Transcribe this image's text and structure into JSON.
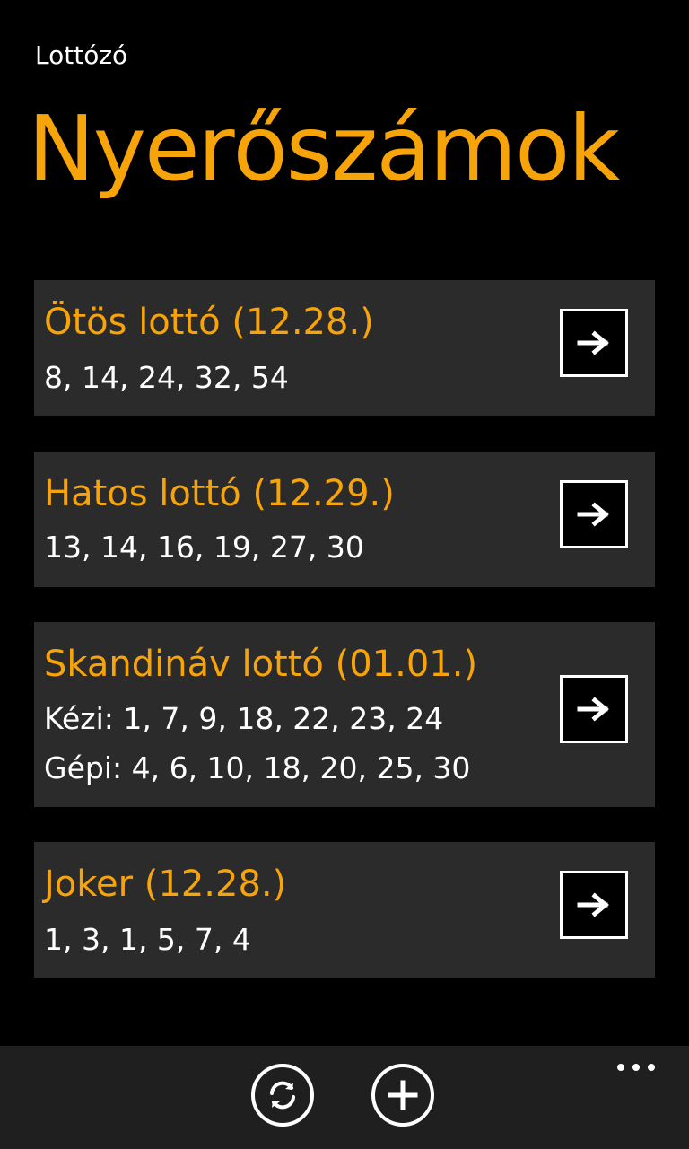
{
  "app": {
    "title": "Lottózó"
  },
  "page": {
    "title": "Nyerőszámok"
  },
  "cards": [
    {
      "title": "Ötös lottó (12.28.)",
      "lines": [
        "8, 14, 24, 32, 54"
      ]
    },
    {
      "title": "Hatos lottó (12.29.)",
      "lines": [
        "13, 14, 16, 19, 27, 30"
      ]
    },
    {
      "title": "Skandináv lottó (01.01.)",
      "lines": [
        "Kézi: 1, 7, 9, 18, 22, 23, 24",
        "Gépi: 4, 6, 10, 18, 20, 25, 30"
      ]
    },
    {
      "title": "Joker (12.28.)",
      "lines": [
        "1, 3, 1, 5, 7, 4"
      ]
    }
  ],
  "icons": {
    "card_action": "arrow-right-icon",
    "refresh": "refresh-icon",
    "add": "add-icon",
    "more": "more-dots-icon"
  },
  "colors": {
    "accent": "#f7a30a",
    "background": "#000000",
    "card": "#2b2b2b",
    "appbar": "#1f1f1f",
    "text": "#ffffff"
  }
}
